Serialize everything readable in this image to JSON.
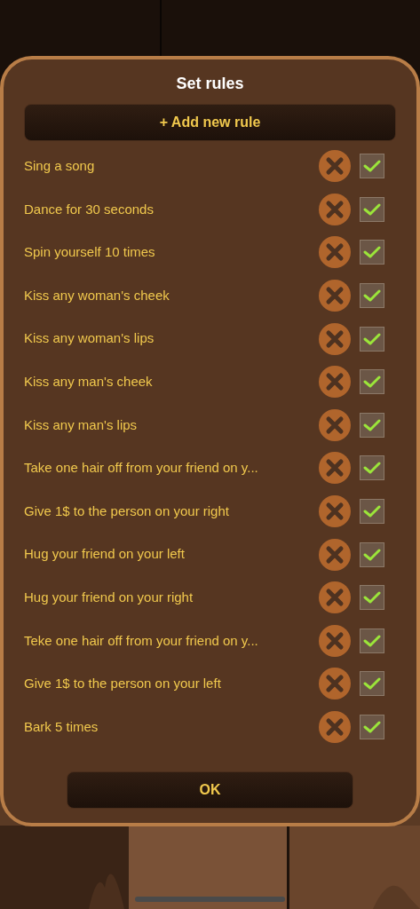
{
  "dialog": {
    "title": "Set rules",
    "add_button": "+ Add new rule",
    "ok_button": "OK"
  },
  "rules": [
    {
      "text": "Sing a song",
      "checked": true
    },
    {
      "text": "Dance for 30 seconds",
      "checked": true
    },
    {
      "text": "Spin yourself 10 times",
      "checked": true
    },
    {
      "text": "Kiss any woman's cheek",
      "checked": true
    },
    {
      "text": "Kiss any woman's lips",
      "checked": true
    },
    {
      "text": "Kiss any man's cheek",
      "checked": true
    },
    {
      "text": "Kiss any man's lips",
      "checked": true
    },
    {
      "text": "Take one hair off from your friend on y...",
      "checked": true
    },
    {
      "text": "Give 1$ to the person on your right",
      "checked": true
    },
    {
      "text": "Hug your friend on your left",
      "checked": true
    },
    {
      "text": "Hug your friend on your right",
      "checked": true
    },
    {
      "text": "Teke one hair off from your friend on y...",
      "checked": true
    },
    {
      "text": "Give 1$ to the person on your left",
      "checked": true
    },
    {
      "text": "Bark 5 times",
      "checked": true
    }
  ]
}
